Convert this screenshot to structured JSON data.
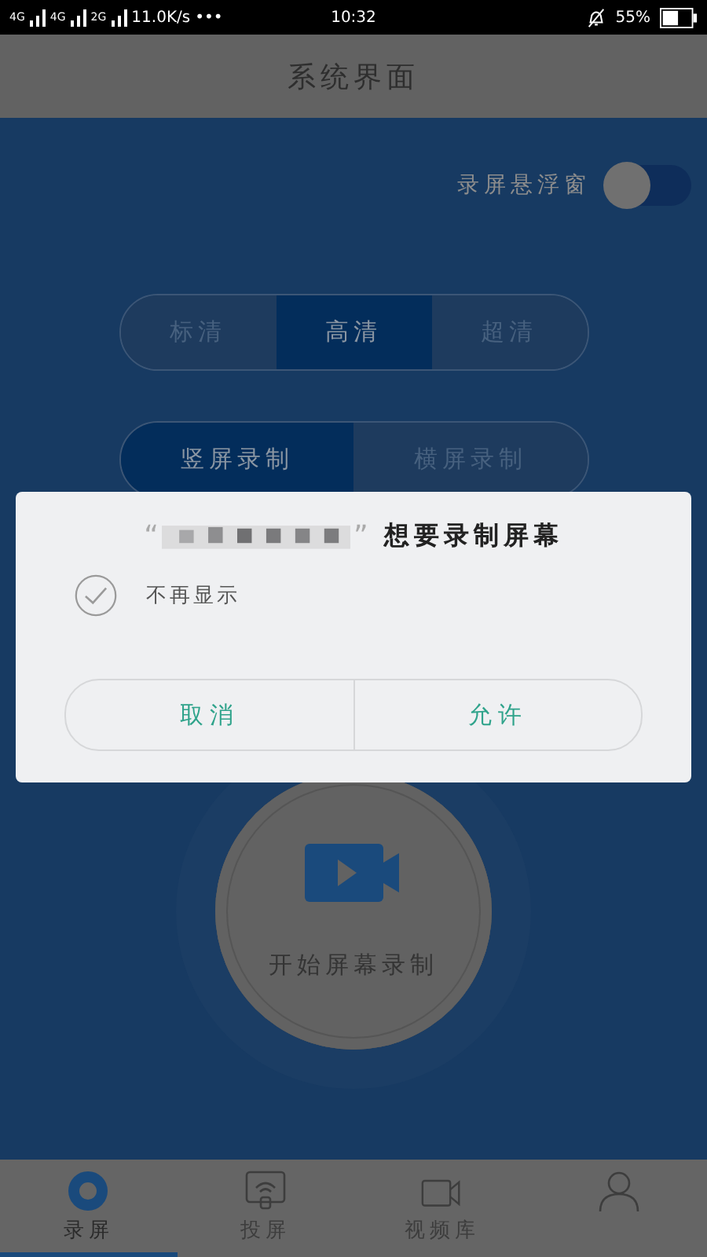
{
  "status_bar": {
    "networks": [
      "4G",
      "4G",
      "2G"
    ],
    "speed": "11.0K/s",
    "dots": "•••",
    "time": "10:32",
    "battery": "55%"
  },
  "title_bar": {
    "title": "系统界面"
  },
  "floating_window": {
    "label": "录屏悬浮窗",
    "on": false
  },
  "quality_tabs": [
    {
      "label": "标清",
      "selected": false
    },
    {
      "label": "高清",
      "selected": true
    },
    {
      "label": "超清",
      "selected": false
    }
  ],
  "orientation_tabs": [
    {
      "label": "竖屏录制",
      "selected": true
    },
    {
      "label": "横屏录制",
      "selected": false
    }
  ],
  "record_button": {
    "label": "开始屏幕录制"
  },
  "dialog": {
    "open_quote": "“",
    "close_quote": "”",
    "title": "想要录制屏幕",
    "dont_show": {
      "label": "不再显示",
      "checked": false
    },
    "buttons": [
      "取消",
      "允许"
    ]
  },
  "bottom_nav": [
    {
      "label": "录屏",
      "kind": "record",
      "selected": true
    },
    {
      "label": "投屏",
      "kind": "cast",
      "selected": false
    },
    {
      "label": "视频库",
      "kind": "library",
      "selected": false
    },
    {
      "kind": "profile",
      "selected": false
    }
  ]
}
